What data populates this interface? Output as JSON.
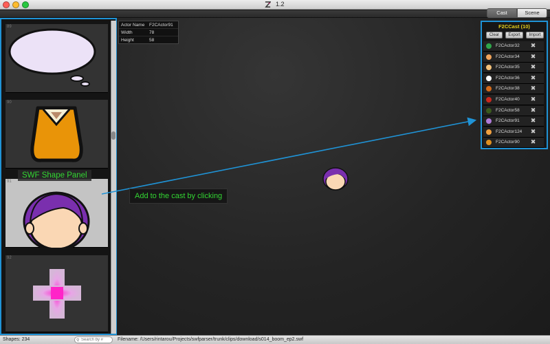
{
  "window": {
    "title": "1.2",
    "colors": {
      "close": "#ff5f57",
      "minimize": "#febc2e",
      "zoom": "#28c840",
      "accent": "#1f93d6",
      "label_green": "#33d633",
      "cast_title": "#e8d21a"
    }
  },
  "tabs": [
    {
      "label": "Cast",
      "selected": true
    },
    {
      "label": "Scene",
      "selected": false
    }
  ],
  "info": {
    "rows": [
      {
        "key": "Actor Name",
        "value": "F2CActor91"
      },
      {
        "key": "Width",
        "value": "78"
      },
      {
        "key": "Height",
        "value": "58"
      }
    ]
  },
  "shape_panel": {
    "label": "SWF Shape Panel",
    "thumbs": [
      {
        "number": "89",
        "icon": "speech-bubble-icon"
      },
      {
        "number": "90",
        "icon": "orange-shirt-icon"
      },
      {
        "number": "91",
        "icon": "girl-face-icon",
        "selected": true
      },
      {
        "number": "92",
        "icon": "pink-cross-icon"
      }
    ]
  },
  "callout": "Add to the cast by clicking",
  "cast": {
    "title": "F2CCast  (10)",
    "buttons": [
      "Clear",
      "Export",
      "Import"
    ],
    "items": [
      {
        "label": "F2CActor32",
        "icon_color": "#2fa64a"
      },
      {
        "label": "F2CActor34",
        "icon_color": "#f0a35a"
      },
      {
        "label": "F2CActor35",
        "icon_color": "#f3c27a"
      },
      {
        "label": "F2CActor36",
        "icon_color": "#ffffff"
      },
      {
        "label": "F2CActor38",
        "icon_color": "#d46a1a"
      },
      {
        "label": "F2CActor40",
        "icon_color": "#c8281e"
      },
      {
        "label": "F2CActor58",
        "icon_color": "#3a5a1e"
      },
      {
        "label": "F2CActor91",
        "icon_color": "#b07ad8"
      },
      {
        "label": "F2CActor124",
        "icon_color": "#f0a040"
      },
      {
        "label": "F2CActor90",
        "icon_color": "#e09020"
      }
    ]
  },
  "status": {
    "shapes": "Shapes: 234",
    "search_placeholder": "Search by #",
    "filename": "Filename: /Users/rintarou/Projects/swfparser/trunk/clips/download/s014_boom_ep2.swf"
  }
}
